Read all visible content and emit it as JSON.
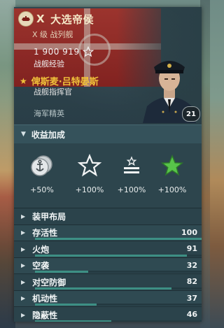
{
  "ship": {
    "tier": "X",
    "name": "大选帝侯",
    "subtitle": "X 级  战列舰",
    "experience": "1 900 919",
    "experience_label": "战舰经验"
  },
  "commander": {
    "name": "俾斯麦·吕特晏斯",
    "role": "战舰指挥官",
    "level": "21",
    "elite_label": "海军精英"
  },
  "bonus_section": {
    "title": "收益加成",
    "items": [
      {
        "icon": "anchor-coin-icon",
        "value": "+50%"
      },
      {
        "icon": "star-outline-icon",
        "value": "+100%"
      },
      {
        "icon": "star-bars-icon",
        "value": "+100%"
      },
      {
        "icon": "green-star-icon",
        "value": "+100%"
      }
    ]
  },
  "stats": {
    "armor_label": "装甲布局",
    "rows": [
      {
        "label": "存活性",
        "value": "100",
        "fill": 1.0
      },
      {
        "label": "火炮",
        "value": "91",
        "fill": 0.91
      },
      {
        "label": "空袭",
        "value": "32",
        "fill": 0.32
      },
      {
        "label": "对空防御",
        "value": "82",
        "fill": 0.82
      },
      {
        "label": "机动性",
        "value": "37",
        "fill": 0.37
      },
      {
        "label": "隐蔽性",
        "value": "46",
        "fill": 0.46
      }
    ]
  },
  "colors": {
    "accent_gold": "#f0c23a",
    "bar_teal": "#3d8f84",
    "green_star": "#58c44a"
  }
}
